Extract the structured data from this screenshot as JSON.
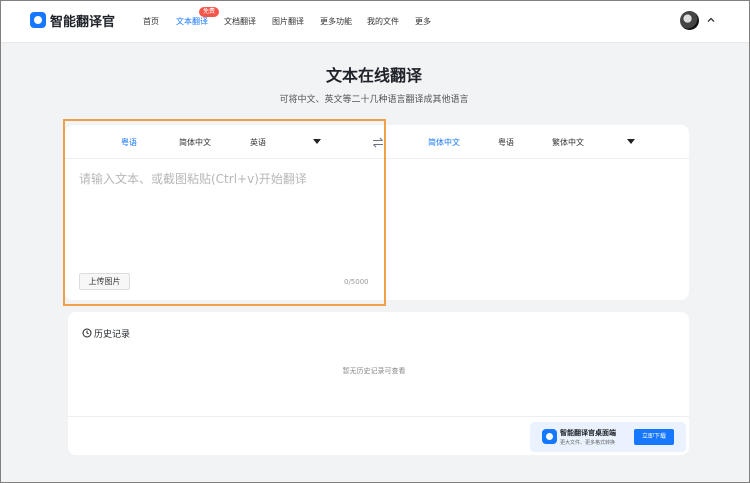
{
  "app": {
    "name": "智能翻译官",
    "nav": [
      {
        "label": "首页"
      },
      {
        "label": "文本翻译",
        "badge": "免费",
        "active": true
      },
      {
        "label": "文档翻译"
      },
      {
        "label": "图片翻译"
      },
      {
        "label": "更多功能"
      },
      {
        "label": "我的文件"
      },
      {
        "label": "更多"
      }
    ]
  },
  "page": {
    "title": "文本在线翻译",
    "subtitle": "可将中文、英文等二十几种语言翻译成其他语言"
  },
  "translator": {
    "source_langs": [
      "粤语",
      "简体中文",
      "英语"
    ],
    "target_langs": [
      "简体中文",
      "粤语",
      "繁体中文"
    ],
    "placeholder": "请输入文本、或截图粘贴(Ctrl+v)开始翻译",
    "upload_label": "上传图片",
    "counter": "0/5000"
  },
  "history": {
    "title": "历史记录",
    "empty_text": "暂无历史记录可查看"
  },
  "promo": {
    "title": "智能翻译官桌面端",
    "subtitle": "更大文件、更多格式转换",
    "button": "立即下载"
  },
  "colors": {
    "accent": "#1677ff",
    "highlight_border": "#f0a04b",
    "badge": "#f5564a"
  }
}
